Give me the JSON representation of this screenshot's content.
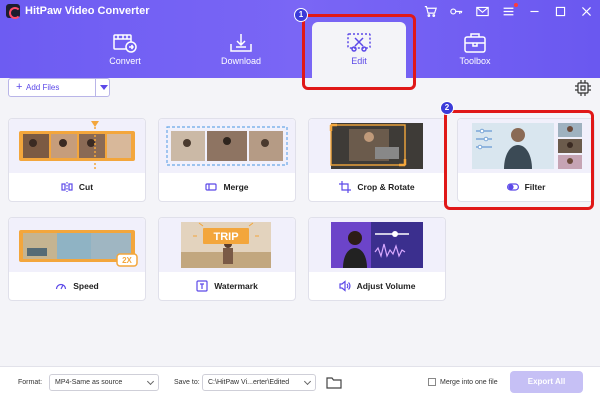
{
  "titlebar": {
    "app_title": "HitPaw Video Converter",
    "icons": [
      "cart-icon",
      "key-icon",
      "mail-icon",
      "menu-icon",
      "minimize-icon",
      "maximize-icon",
      "close-icon"
    ]
  },
  "nav": {
    "tabs": [
      {
        "label": "Convert",
        "icon": "convert-icon"
      },
      {
        "label": "Download",
        "icon": "download-icon"
      },
      {
        "label": "Edit",
        "icon": "edit-icon",
        "active": true
      },
      {
        "label": "Toolbox",
        "icon": "toolbox-icon"
      }
    ]
  },
  "annotations": {
    "badge1": "1",
    "badge2": "2",
    "highlight_color": "#e01818"
  },
  "toolbar": {
    "add_files_label": "Add Files",
    "settings_icon": "hardware-acceleration-icon"
  },
  "tools": [
    {
      "label": "Cut",
      "icon": "cut-icon"
    },
    {
      "label": "Merge",
      "icon": "merge-icon"
    },
    {
      "label": "Crop & Rotate",
      "icon": "crop-icon"
    },
    {
      "label": "Filter",
      "icon": "filter-icon"
    },
    {
      "label": "Speed",
      "icon": "speed-icon",
      "badge": "2X"
    },
    {
      "label": "Watermark",
      "icon": "watermark-icon",
      "thumb_text": "TRIP"
    },
    {
      "label": "Adjust Volume",
      "icon": "volume-icon"
    }
  ],
  "bottom": {
    "format_label": "Format:",
    "format_value": "MP4-Same as source",
    "save_label": "Save to:",
    "save_value": "C:\\HitPaw Vi...erter\\Edited",
    "merge_label": "Merge into one file",
    "export_label": "Export All"
  },
  "colors": {
    "accent": "#5c49e8",
    "header": "#7060f2"
  }
}
